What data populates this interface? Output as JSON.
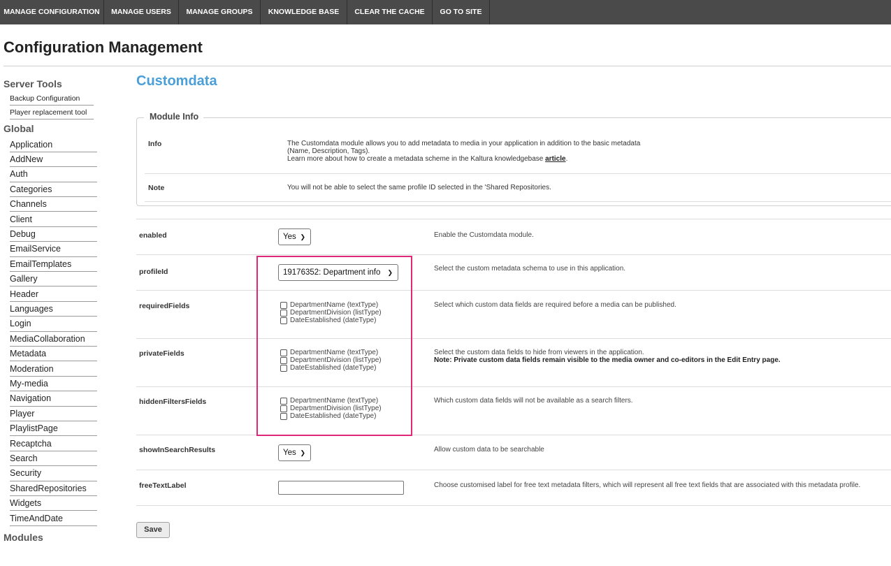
{
  "topnav": [
    "MANAGE CONFIGURATION",
    "MANAGE USERS",
    "MANAGE GROUPS",
    "KNOWLEDGE BASE",
    "CLEAR THE CACHE",
    "GO TO SITE"
  ],
  "page_title": "Configuration Management",
  "sidebar": {
    "server_tools_head": "Server Tools",
    "server_tools": [
      "Backup Configuration",
      "Player replacement tool"
    ],
    "global_head": "Global",
    "global_items": [
      "Application",
      "AddNew",
      "Auth",
      "Categories",
      "Channels",
      "Client",
      "Debug",
      "EmailService",
      "EmailTemplates",
      "Gallery",
      "Header",
      "Languages",
      "Login",
      "MediaCollaboration",
      "Metadata",
      "Moderation",
      "My-media",
      "Navigation",
      "Player",
      "PlaylistPage",
      "Recaptcha",
      "Search",
      "Security",
      "SharedRepositories",
      "Widgets",
      "TimeAndDate"
    ],
    "modules_head": "Modules"
  },
  "module": {
    "title": "Customdata",
    "info_legend": "Module Info",
    "info_label": "Info",
    "info_line1": "The Customdata module allows you to add metadata to media in your application in addition to the basic metadata",
    "info_line2": "(Name, Description, Tags).",
    "info_line3_pre": "Learn more about how to create a metadata scheme in the Kaltura knowledgebase ",
    "info_link": "article",
    "info_line3_post": ".",
    "note_label": "Note",
    "note_text": "You will not be able to select the same profile ID selected in the 'Shared Repositories."
  },
  "fields": {
    "enabled": {
      "label": "enabled",
      "value": "Yes",
      "desc": "Enable the Customdata module."
    },
    "profileId": {
      "label": "profileId",
      "value": "19176352: Department info",
      "desc": "Select the custom metadata schema to use in this application."
    },
    "requiredFields": {
      "label": "requiredFields",
      "options": [
        "DepartmentName (textType)",
        "DepartmentDivision (listType)",
        "DateEstablished (dateType)"
      ],
      "desc": "Select which custom data fields are required before a media can be published."
    },
    "privateFields": {
      "label": "privateFields",
      "options": [
        "DepartmentName (textType)",
        "DepartmentDivision (listType)",
        "DateEstablished (dateType)"
      ],
      "desc": "Select the custom data fields to hide from viewers in the application.",
      "note": "Note: Private custom data fields remain visible to the media owner and co-editors in the Edit Entry page."
    },
    "hiddenFiltersFields": {
      "label": "hiddenFiltersFields",
      "options": [
        "DepartmentName (textType)",
        "DepartmentDivision (listType)",
        "DateEstablished (dateType)"
      ],
      "desc": "Which custom data fields will not be available as a search filters."
    },
    "showInSearchResults": {
      "label": "showInSearchResults",
      "value": "Yes",
      "desc": "Allow custom data to be searchable"
    },
    "freeTextLabel": {
      "label": "freeTextLabel",
      "value": "",
      "desc": "Choose customised label for free text metadata filters, which will represent all free text fields that are associated with this metadata profile."
    }
  },
  "save_label": "Save",
  "colors": {
    "topnav_bg": "#4a4a4a",
    "module_title": "#4a9fd8",
    "highlight_border": "#e0287a"
  }
}
